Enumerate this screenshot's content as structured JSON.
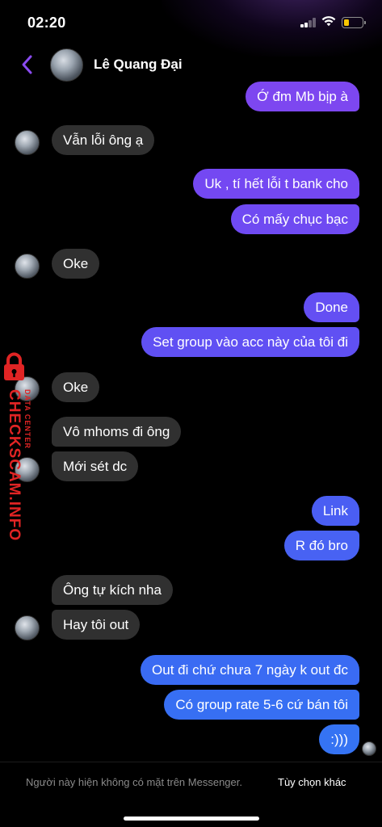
{
  "status_bar": {
    "time": "02:20",
    "battery_level": 0.2,
    "battery_color": "#f7c600"
  },
  "header": {
    "contact_name": "Lê Quang Đại",
    "back_icon": "chevron-left-icon",
    "accent_color": "#8a4bf0"
  },
  "messages": [
    {
      "side": "out",
      "text": "Ớ đm Mb bịp à",
      "color": "#7d47f0"
    },
    {
      "side": "in",
      "text": "Vẫn lỗi ông ạ"
    },
    {
      "side": "out",
      "text": "Uk , tí hết lỗi t bank cho",
      "color": "#7448f2"
    },
    {
      "side": "out",
      "text": "Có mấy chục bạc",
      "color": "#6f4af2"
    },
    {
      "side": "in",
      "text": "Oke"
    },
    {
      "side": "out",
      "text": "Done",
      "color": "#644ff3"
    },
    {
      "side": "out",
      "text": "Set group vào acc này của tôi đi",
      "color": "#6050f3"
    },
    {
      "side": "in",
      "text": "Oke"
    },
    {
      "side": "in",
      "text": "Vô mhoms đi ông"
    },
    {
      "side": "in",
      "text": "Mới sét dc"
    },
    {
      "side": "out",
      "text": "Link",
      "color": "#4a5ef3"
    },
    {
      "side": "out",
      "text": "R đó bro",
      "color": "#4862f3"
    },
    {
      "side": "in",
      "text": "Ông tự kích nha"
    },
    {
      "side": "in",
      "text": "Hay tôi out"
    },
    {
      "side": "out",
      "text": "Out đi chứ chưa 7 ngày k out đc",
      "color": "#3a6bf3"
    },
    {
      "side": "out",
      "text": "Có group rate 5-6 cứ bán tôi",
      "color": "#376ff3"
    },
    {
      "side": "out",
      "text": ":)))",
      "color": "#3573f3"
    }
  ],
  "watermark": {
    "text": "CHECKSCAM.INFO",
    "subtext": "DATA CENTER",
    "color": "#e02424"
  },
  "footer": {
    "note": "Người này hiện không có mặt trên Messenger.",
    "action": "Tùy chọn khác"
  }
}
